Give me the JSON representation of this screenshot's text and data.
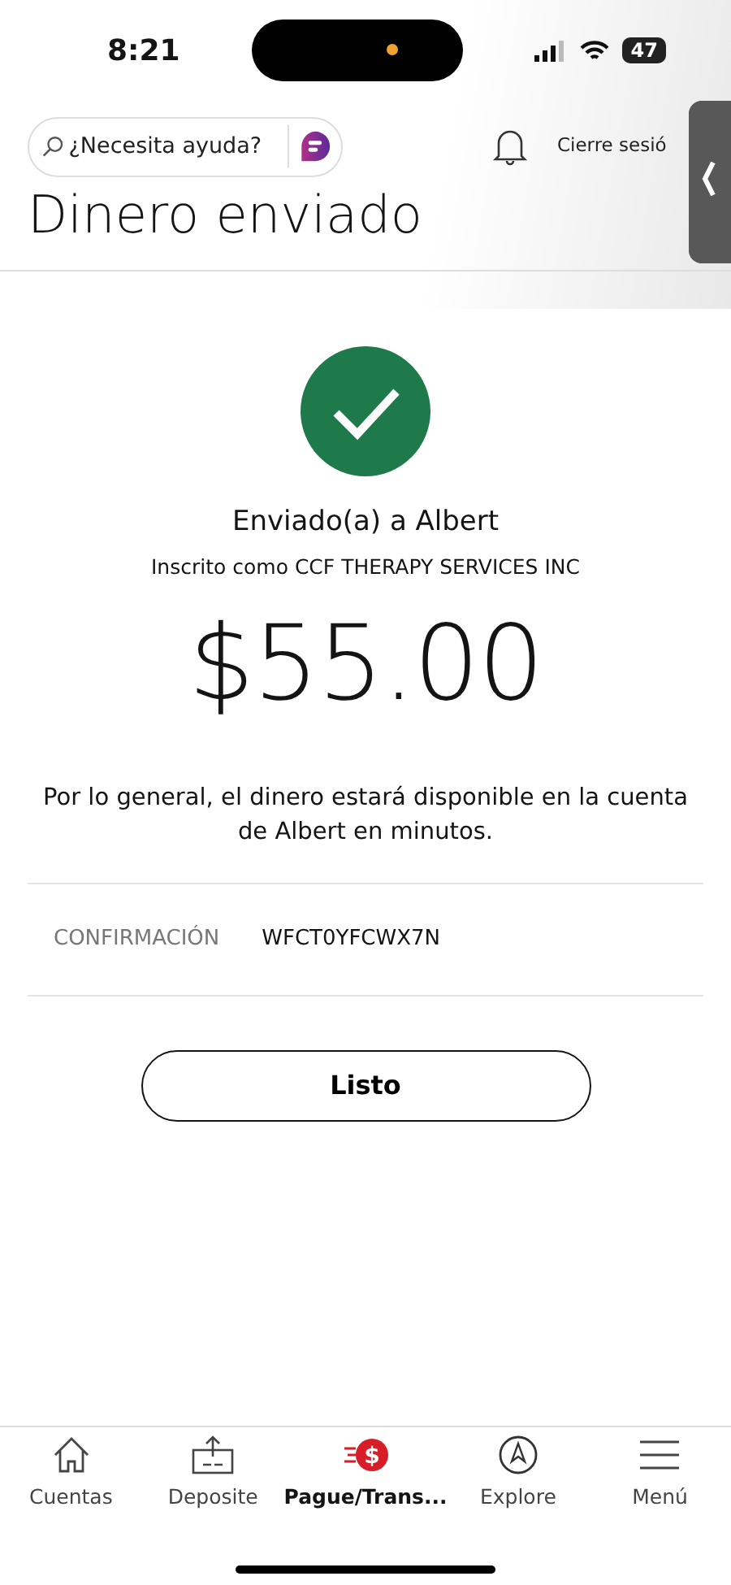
{
  "status_bar": {
    "time": "8:21",
    "battery": "47"
  },
  "header": {
    "search": {
      "placeholder": "¿Necesita ayuda?"
    },
    "logout": "Cierre sesió"
  },
  "title": "Dinero enviado",
  "confirmation": {
    "recipient": "Enviado(a) a Albert",
    "enrolled_as": "Inscrito como CCF THERAPY SERVICES INC",
    "amount": "$55.00",
    "note": "Por lo general, el dinero estará disponible en la cuenta de Albert en minutos.",
    "label": "CONFIRMACIÓN",
    "code": "WFCT0YFCWX7N"
  },
  "buttons": [
    "Listo"
  ],
  "tab_bar": [
    {
      "kind": "home",
      "label": "Cuentas",
      "selected": false
    },
    {
      "kind": "deposit",
      "label": "Deposite",
      "selected": false
    },
    {
      "kind": "pay",
      "label": "Pague/Trans...",
      "selected": true,
      "icon_text": "$"
    },
    {
      "kind": "explore",
      "label": "Explore",
      "selected": false
    },
    {
      "kind": "menu",
      "label": "Menú",
      "selected": false
    }
  ]
}
